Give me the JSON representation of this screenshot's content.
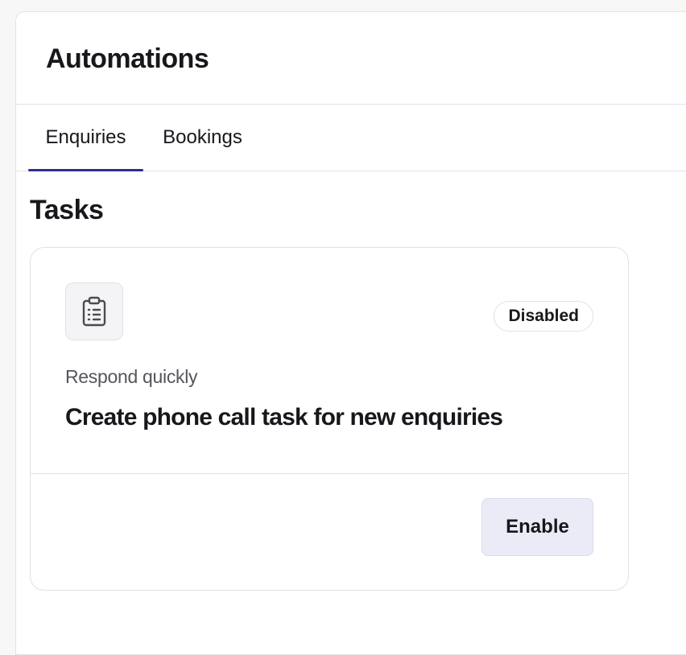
{
  "header": {
    "title": "Automations"
  },
  "tabs": [
    {
      "label": "Enquiries",
      "active": true
    },
    {
      "label": "Bookings",
      "active": false
    }
  ],
  "section": {
    "title": "Tasks"
  },
  "card": {
    "icon": "clipboard-list-icon",
    "status": "Disabled",
    "subtitle": "Respond quickly",
    "title": "Create phone call task for new enquiries",
    "action_label": "Enable"
  },
  "colors": {
    "accent": "#2d2f8f",
    "button_bg": "#ebebf8"
  }
}
